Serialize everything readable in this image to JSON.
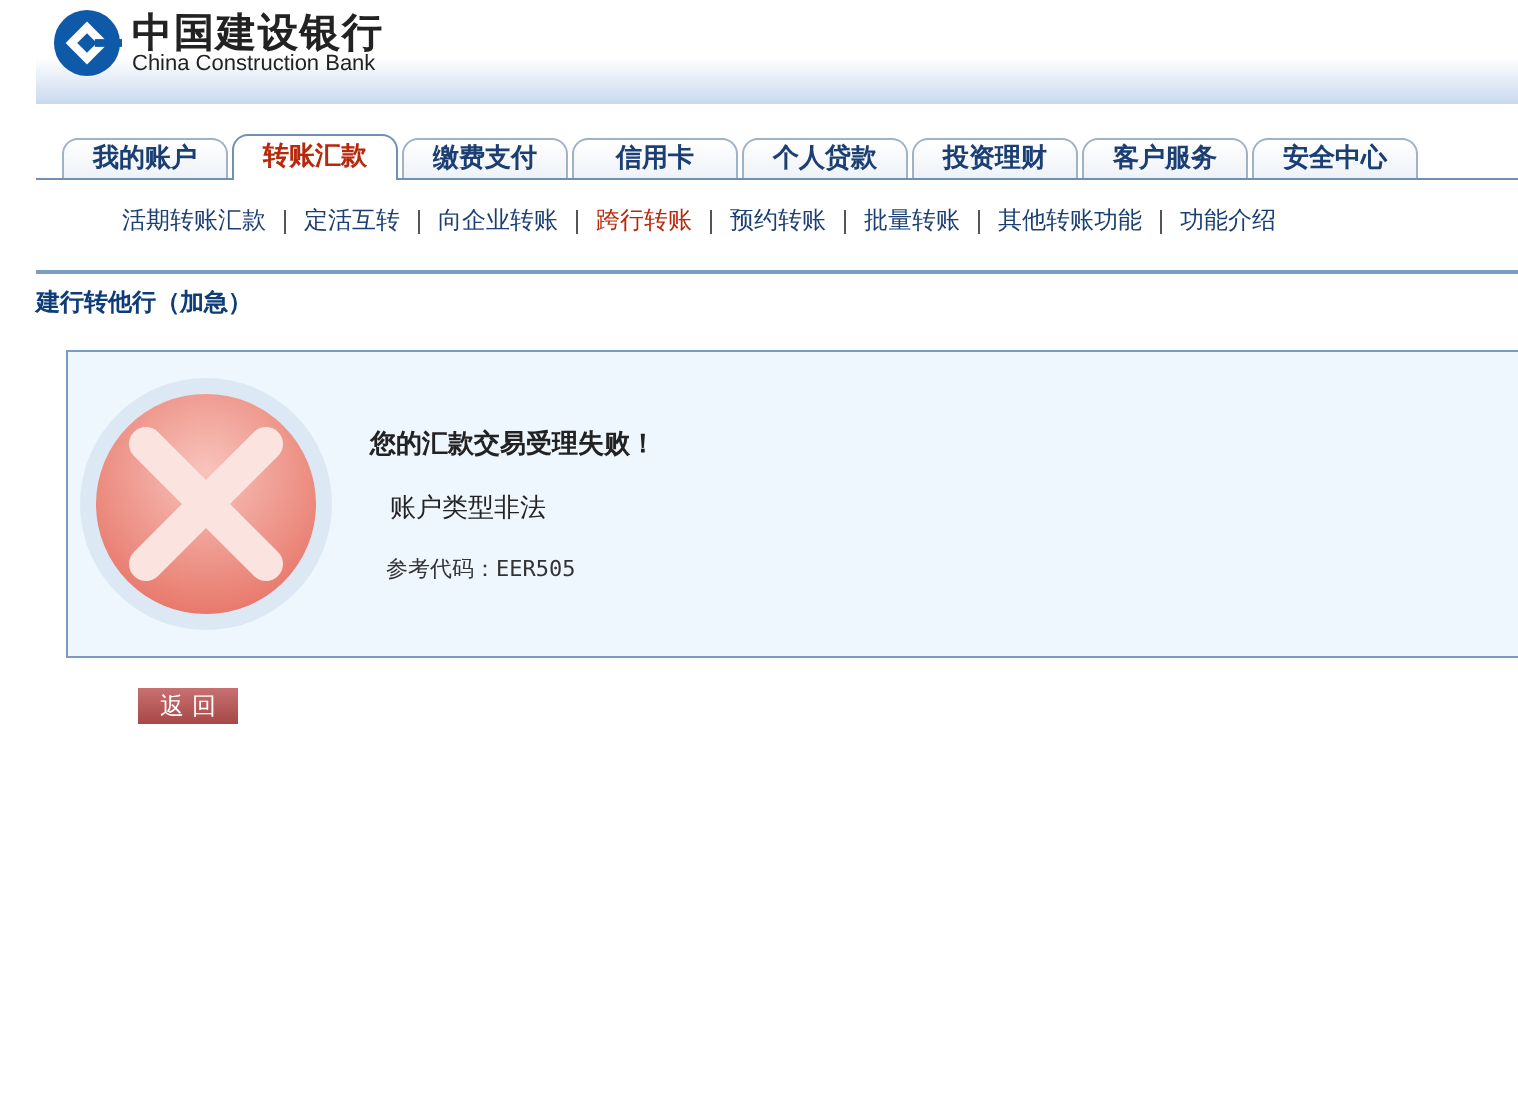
{
  "logo": {
    "name_zh": "中国建设银行",
    "name_en": "China Construction Bank"
  },
  "tabs": [
    {
      "label": "我的账户",
      "selected": false
    },
    {
      "label": "转账汇款",
      "selected": true
    },
    {
      "label": "缴费支付",
      "selected": false
    },
    {
      "label": "信用卡",
      "selected": false
    },
    {
      "label": "个人贷款",
      "selected": false
    },
    {
      "label": "投资理财",
      "selected": false
    },
    {
      "label": "客户服务",
      "selected": false
    },
    {
      "label": "安全中心",
      "selected": false
    }
  ],
  "subnav": [
    {
      "label": "活期转账汇款",
      "selected": false
    },
    {
      "label": "定活互转",
      "selected": false
    },
    {
      "label": "向企业转账",
      "selected": false
    },
    {
      "label": "跨行转账",
      "selected": true
    },
    {
      "label": "预约转账",
      "selected": false
    },
    {
      "label": "批量转账",
      "selected": false
    },
    {
      "label": "其他转账功能",
      "selected": false
    },
    {
      "label": "功能介绍",
      "selected": false
    }
  ],
  "section_title": "建行转他行（加急）",
  "result": {
    "kind": "error",
    "title": "您的汇款交易受理失败！",
    "message": "账户类型非法",
    "reference": "参考代码：EER505"
  },
  "buttons": [
    {
      "label": "返 回"
    }
  ]
}
